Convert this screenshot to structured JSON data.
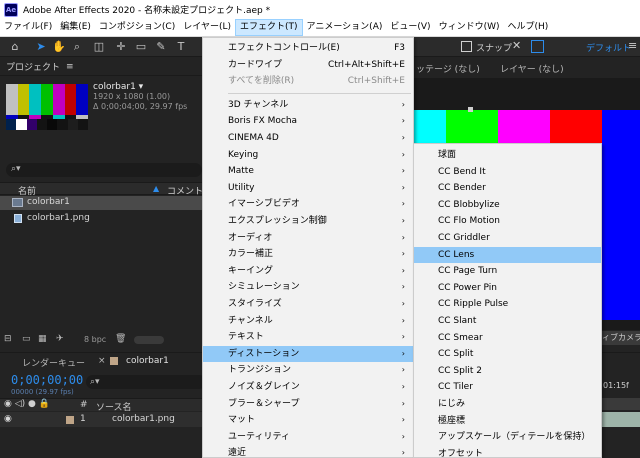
{
  "window": {
    "title": "Adobe After Effects 2020 - 名称未設定プロジェクト.aep *",
    "logo": "Ae"
  },
  "menubar": [
    {
      "label": "ファイル(F)",
      "active": false
    },
    {
      "label": "編集(E)",
      "active": false
    },
    {
      "label": "コンポジション(C)",
      "active": false
    },
    {
      "label": "レイヤー(L)",
      "active": false
    },
    {
      "label": "エフェクト(T)",
      "active": true
    },
    {
      "label": "アニメーション(A)",
      "active": false
    },
    {
      "label": "ビュー(V)",
      "active": false
    },
    {
      "label": "ウィンドウ(W)",
      "active": false
    },
    {
      "label": "ヘルプ(H)",
      "active": false
    }
  ],
  "toolbar": {
    "snap_label": "スナップ",
    "workspace": "デフォルト",
    "menu_icon": "≡"
  },
  "project": {
    "title": "プロジェクト",
    "menu_icon": "≡",
    "item_name": "colorbar1 ▾",
    "item_size": "1920 x 1080 (1.00)",
    "item_duration": "Δ 0;00;04;00, 29.97 fps",
    "search_icon": "⌕▾",
    "col_name": "名前",
    "sort_icon": "▲",
    "col_comment": "コメント",
    "rows": [
      {
        "label": "colorbar1",
        "selected": true,
        "icon": "composition-icon"
      },
      {
        "label": "colorbar1.png",
        "selected": false,
        "icon": "file-icon"
      }
    ],
    "bpc": "8 bpc",
    "trash_icon": "🗑"
  },
  "viewer": {
    "tab1": "ッテージ (なし)",
    "tab2": "レイヤー (なし)",
    "footer_text": "ィブカメラ"
  },
  "timeline": {
    "tab_render": "レンダーキュー",
    "close_icon": "×",
    "tab_comp": "colorbar1",
    "timecode": "0;00;00;00",
    "fps": "00000 (29.97 fps)",
    "search_icon": "⌕▾",
    "col_eye": "◉ ◁) ● 🔒",
    "col_hash": "#",
    "col_source": "ソース名",
    "layer": {
      "vis": "◉",
      "num": "1",
      "name": "colorbar1.png"
    },
    "right_time": "01:15f"
  },
  "effect_menu": [
    {
      "label": "エフェクトコントロール(E)",
      "shortcut": "F3",
      "submenu": false,
      "disabled": false,
      "highlight": false
    },
    {
      "label": "カードワイプ",
      "shortcut": "Ctrl+Alt+Shift+E",
      "submenu": false,
      "disabled": false,
      "highlight": false
    },
    {
      "label": "すべてを削除(R)",
      "shortcut": "Ctrl+Shift+E",
      "submenu": false,
      "disabled": true,
      "highlight": false
    },
    {
      "sep": true
    },
    {
      "label": "3D チャンネル",
      "shortcut": "",
      "submenu": true,
      "disabled": false,
      "highlight": false
    },
    {
      "label": "Boris FX Mocha",
      "shortcut": "",
      "submenu": true,
      "disabled": false,
      "highlight": false
    },
    {
      "label": "CINEMA 4D",
      "shortcut": "",
      "submenu": true,
      "disabled": false,
      "highlight": false
    },
    {
      "label": "Keying",
      "shortcut": "",
      "submenu": true,
      "disabled": false,
      "highlight": false
    },
    {
      "label": "Matte",
      "shortcut": "",
      "submenu": true,
      "disabled": false,
      "highlight": false
    },
    {
      "label": "Utility",
      "shortcut": "",
      "submenu": true,
      "disabled": false,
      "highlight": false
    },
    {
      "label": "イマーシブビデオ",
      "shortcut": "",
      "submenu": true,
      "disabled": false,
      "highlight": false
    },
    {
      "label": "エクスプレッション制御",
      "shortcut": "",
      "submenu": true,
      "disabled": false,
      "highlight": false
    },
    {
      "label": "オーディオ",
      "shortcut": "",
      "submenu": true,
      "disabled": false,
      "highlight": false
    },
    {
      "label": "カラー補正",
      "shortcut": "",
      "submenu": true,
      "disabled": false,
      "highlight": false
    },
    {
      "label": "キーイング",
      "shortcut": "",
      "submenu": true,
      "disabled": false,
      "highlight": false
    },
    {
      "label": "シミュレーション",
      "shortcut": "",
      "submenu": true,
      "disabled": false,
      "highlight": false
    },
    {
      "label": "スタイライズ",
      "shortcut": "",
      "submenu": true,
      "disabled": false,
      "highlight": false
    },
    {
      "label": "チャンネル",
      "shortcut": "",
      "submenu": true,
      "disabled": false,
      "highlight": false
    },
    {
      "label": "テキスト",
      "shortcut": "",
      "submenu": true,
      "disabled": false,
      "highlight": false
    },
    {
      "label": "ディストーション",
      "shortcut": "",
      "submenu": true,
      "disabled": false,
      "highlight": true
    },
    {
      "label": "トランジション",
      "shortcut": "",
      "submenu": true,
      "disabled": false,
      "highlight": false
    },
    {
      "label": "ノイズ＆グレイン",
      "shortcut": "",
      "submenu": true,
      "disabled": false,
      "highlight": false
    },
    {
      "label": "ブラー＆シャープ",
      "shortcut": "",
      "submenu": true,
      "disabled": false,
      "highlight": false
    },
    {
      "label": "マット",
      "shortcut": "",
      "submenu": true,
      "disabled": false,
      "highlight": false
    },
    {
      "label": "ユーティリティ",
      "shortcut": "",
      "submenu": true,
      "disabled": false,
      "highlight": false
    },
    {
      "label": "遠近",
      "shortcut": "",
      "submenu": true,
      "disabled": false,
      "highlight": false
    }
  ],
  "distortion_submenu": [
    {
      "label": "球面",
      "highlight": false
    },
    {
      "label": "CC Bend It",
      "highlight": false
    },
    {
      "label": "CC Bender",
      "highlight": false
    },
    {
      "label": "CC Blobbylize",
      "highlight": false
    },
    {
      "label": "CC Flo Motion",
      "highlight": false
    },
    {
      "label": "CC Griddler",
      "highlight": false
    },
    {
      "label": "CC Lens",
      "highlight": true
    },
    {
      "label": "CC Page Turn",
      "highlight": false
    },
    {
      "label": "CC Power Pin",
      "highlight": false
    },
    {
      "label": "CC Ripple Pulse",
      "highlight": false
    },
    {
      "label": "CC Slant",
      "highlight": false
    },
    {
      "label": "CC Smear",
      "highlight": false
    },
    {
      "label": "CC Split",
      "highlight": false
    },
    {
      "label": "CC Split 2",
      "highlight": false
    },
    {
      "label": "CC Tiler",
      "highlight": false
    },
    {
      "label": "にじみ",
      "highlight": false
    },
    {
      "label": "極座標",
      "highlight": false
    },
    {
      "label": "アップスケール（ディテールを保持）",
      "highlight": false
    },
    {
      "label": "オフセット",
      "highlight": false
    }
  ],
  "colors": {
    "accent": "#2d8ceb",
    "menu_highlight": "#91c9f7",
    "menu_bg": "#f2f2f2"
  }
}
